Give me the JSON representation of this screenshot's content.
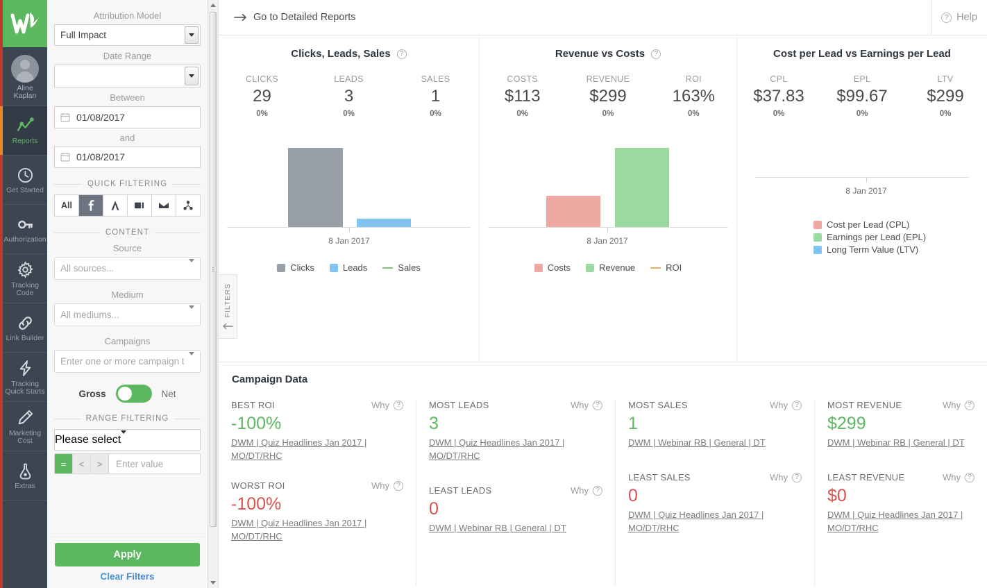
{
  "rail": {
    "logo_name": "wicked-reports-logo",
    "user": {
      "name_line1": "Aline",
      "name_line2": "Kaplan"
    },
    "items": [
      {
        "label": "Reports",
        "icon": "chart-line-icon",
        "active": true
      },
      {
        "label": "Get Started",
        "icon": "clock-icon",
        "active": false
      },
      {
        "label": "Authorization",
        "icon": "key-icon",
        "active": false
      },
      {
        "label_l1": "Tracking",
        "label_l2": "Code",
        "label": "Tracking Code",
        "icon": "gear-icon",
        "active": false
      },
      {
        "label": "Link Builder",
        "icon": "link-icon",
        "active": false
      },
      {
        "label_l1": "Tracking",
        "label_l2": "Quick Starts",
        "label": "Tracking Quick Starts",
        "icon": "lightning-icon",
        "active": false
      },
      {
        "label_l1": "Marketing",
        "label_l2": "Cost",
        "label": "Marketing Cost",
        "icon": "pencil-icon",
        "active": false
      },
      {
        "label": "Extras",
        "icon": "flask-icon",
        "active": false
      }
    ]
  },
  "filters": {
    "attribution_model": {
      "label": "Attribution Model",
      "value": "Full Impact"
    },
    "date_range": {
      "label": "Date Range",
      "value": ""
    },
    "between": {
      "label": "Between",
      "value": "01/08/2017"
    },
    "and": {
      "label": "and",
      "value": "01/08/2017"
    },
    "quick_filtering": {
      "title": "QUICK FILTERING",
      "buttons": [
        {
          "label": "All",
          "icon": "all-text-icon",
          "active": false
        },
        {
          "label": "",
          "icon": "facebook-icon",
          "active": true
        },
        {
          "label": "",
          "icon": "adwords-icon",
          "active": false
        },
        {
          "label": "",
          "icon": "ad-banner-icon",
          "active": false
        },
        {
          "label": "",
          "icon": "envelope-icon",
          "active": false
        },
        {
          "label": "",
          "icon": "network-share-icon",
          "active": false
        }
      ]
    },
    "content": {
      "title": "CONTENT",
      "source": {
        "label": "Source",
        "placeholder": "All sources..."
      },
      "medium": {
        "label": "Medium",
        "placeholder": "All mediums..."
      },
      "campaigns": {
        "label": "Campaigns",
        "placeholder": "Enter one or more campaign t"
      }
    },
    "gross_net": {
      "left": "Gross",
      "right": "Net",
      "state": "Gross"
    },
    "range_filtering": {
      "title": "RANGE FILTERING",
      "select_value": "Please select",
      "operators": [
        "=",
        "<",
        ">"
      ],
      "active_operator": "=",
      "value_placeholder": "Enter value"
    },
    "apply_label": "Apply",
    "clear_label": "Clear Filters"
  },
  "topbar": {
    "detailed_reports_label": "Go to Detailed Reports",
    "help_label": "Help"
  },
  "filters_tab": {
    "label": "FILTERS"
  },
  "chart_data": [
    {
      "type": "bar",
      "title": "Clicks, Leads, Sales",
      "categories": [
        "8 Jan 2017"
      ],
      "xlabel": "",
      "ylabel": "",
      "grid": false,
      "legend_position": "bottom",
      "series": [
        {
          "name": "Clicks",
          "values": [
            29
          ],
          "color": "#9aa0a8",
          "kind": "bar"
        },
        {
          "name": "Leads",
          "values": [
            3
          ],
          "color": "#83c3f0",
          "kind": "bar"
        },
        {
          "name": "Sales",
          "values": [
            1
          ],
          "color": "#7fc47f",
          "kind": "line"
        }
      ],
      "kpis": [
        {
          "label": "CLICKS",
          "value": "29",
          "delta": "0%"
        },
        {
          "label": "LEADS",
          "value": "3",
          "delta": "0%"
        },
        {
          "label": "SALES",
          "value": "1",
          "delta": "0%"
        }
      ]
    },
    {
      "type": "bar",
      "title": "Revenue vs Costs",
      "categories": [
        "8 Jan 2017"
      ],
      "xlabel": "",
      "ylabel": "",
      "grid": false,
      "legend_position": "bottom",
      "series": [
        {
          "name": "Costs",
          "values": [
            113
          ],
          "color": "#eda8a2",
          "kind": "bar"
        },
        {
          "name": "Revenue",
          "values": [
            299
          ],
          "color": "#9ad9a0",
          "kind": "bar"
        },
        {
          "name": "ROI",
          "values": [
            163
          ],
          "color": "#f0ab5e",
          "kind": "line"
        }
      ],
      "kpis": [
        {
          "label": "COSTS",
          "value": "$113",
          "delta": "0%"
        },
        {
          "label": "REVENUE",
          "value": "$299",
          "delta": "0%"
        },
        {
          "label": "ROI",
          "value": "163%",
          "delta": "0%"
        }
      ]
    },
    {
      "type": "bar",
      "title": "Cost per Lead vs Earnings per Lead",
      "categories": [
        "8 Jan 2017"
      ],
      "xlabel": "",
      "ylabel": "",
      "grid": false,
      "legend_position": "bottom",
      "series": [
        {
          "name": "Cost per Lead (CPL)",
          "values": [
            37.83
          ],
          "color": "#eda8a2",
          "kind": "bar"
        },
        {
          "name": "Earnings per Lead (EPL)",
          "values": [
            99.67
          ],
          "color": "#9ad9a0",
          "kind": "bar"
        },
        {
          "name": "Long Term Value (LTV)",
          "values": [
            299
          ],
          "color": "#83c3f0",
          "kind": "bar"
        }
      ],
      "kpis": [
        {
          "label": "CPL",
          "value": "$37.83",
          "delta": "0%"
        },
        {
          "label": "EPL",
          "value": "$99.67",
          "delta": "0%"
        },
        {
          "label": "LTV",
          "value": "$299",
          "delta": "0%"
        }
      ]
    }
  ],
  "campaign": {
    "heading": "Campaign Data",
    "why_label": "Why",
    "columns": [
      {
        "blocks": [
          {
            "label": "BEST ROI",
            "value": "-100%",
            "tone": "pos",
            "link_l1": "DWM | Quiz Headlines Jan 2017 |",
            "link_l2": "MO/DT/RHC"
          },
          {
            "label": "WORST ROI",
            "value": "-100%",
            "tone": "neg",
            "link_l1": "DWM | Quiz Headlines Jan 2017 |",
            "link_l2": "MO/DT/RHC"
          }
        ]
      },
      {
        "blocks": [
          {
            "label": "MOST LEADS",
            "value": "3",
            "tone": "pos",
            "link_l1": "DWM | Quiz Headlines Jan 2017 |",
            "link_l2": "MO/DT/RHC"
          },
          {
            "label": "LEAST LEADS",
            "value": "0",
            "tone": "neg",
            "link_l1": "DWM | Webinar RB | General | DT",
            "link_l2": ""
          }
        ]
      },
      {
        "blocks": [
          {
            "label": "MOST SALES",
            "value": "1",
            "tone": "pos",
            "link_l1": "DWM | Webinar RB | General | DT",
            "link_l2": ""
          },
          {
            "label": "LEAST SALES",
            "value": "0",
            "tone": "neg",
            "link_l1": "DWM | Quiz Headlines Jan 2017 |",
            "link_l2": "MO/DT/RHC"
          }
        ]
      },
      {
        "blocks": [
          {
            "label": "MOST REVENUE",
            "value": "$299",
            "tone": "pos",
            "link_l1": "DWM | Webinar RB | General | DT",
            "link_l2": ""
          },
          {
            "label": "LEAST REVENUE",
            "value": "$0",
            "tone": "neg",
            "link_l1": "DWM | Quiz Headlines Jan 2017 |",
            "link_l2": "MO/DT/RHC"
          }
        ]
      }
    ]
  },
  "colors": {
    "brand_green": "#5cb860",
    "rail_bg": "#3c4552",
    "accent_red": "#c0392b",
    "active_orange": "#e8891f",
    "clicks": "#9aa0a8",
    "leads": "#83c3f0",
    "sales": "#7fc47f",
    "costs": "#eda8a2",
    "revenue": "#9ad9a0",
    "roi": "#f0ab5e",
    "link_blue": "#4a90d9",
    "negative_red": "#d9534f"
  }
}
